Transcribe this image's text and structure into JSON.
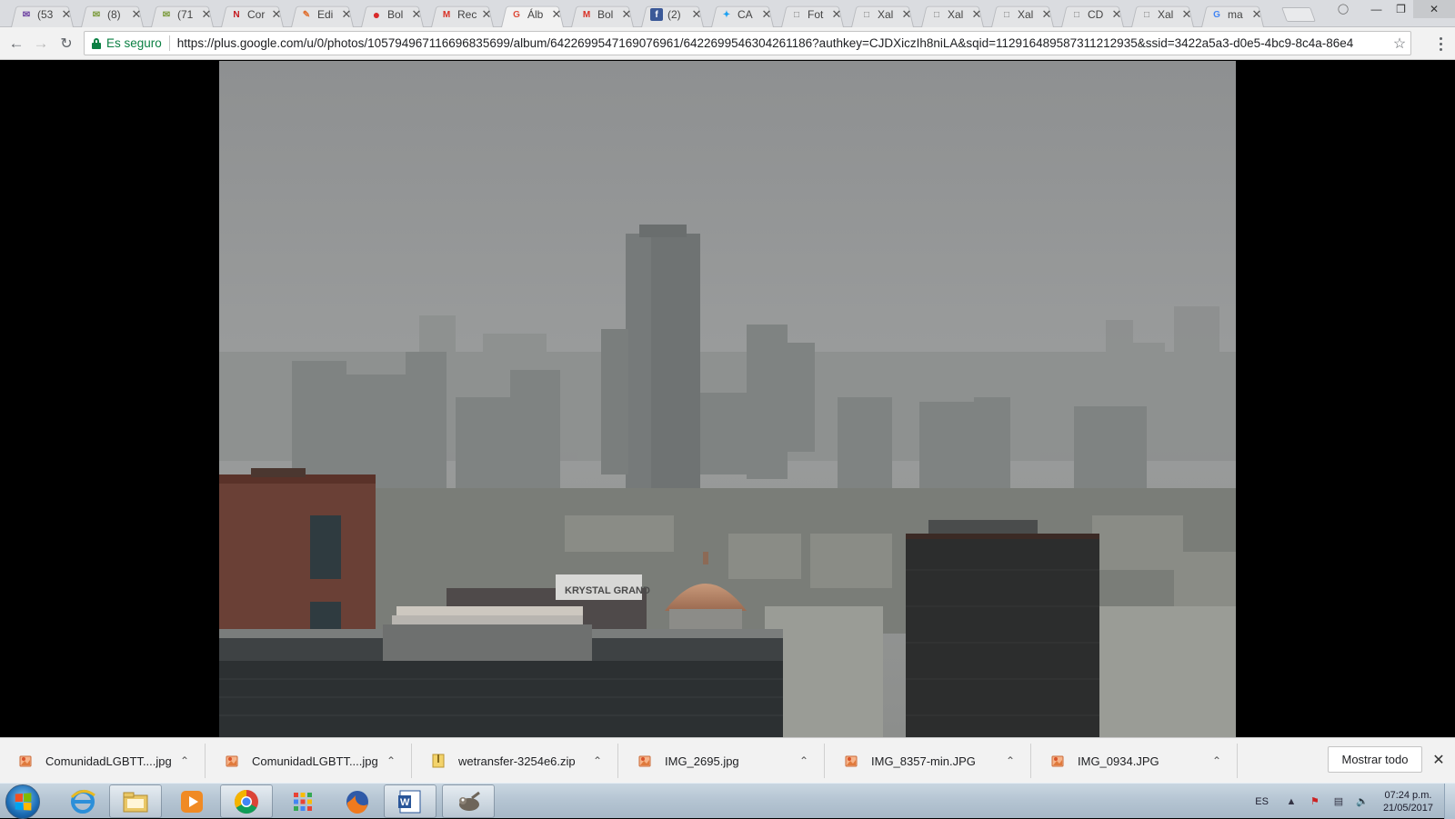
{
  "browser": {
    "tabs": [
      {
        "title": "(53",
        "icon": "mail-icon",
        "color": "#6b3fa0"
      },
      {
        "title": "(8)",
        "icon": "envelope-icon",
        "color": "#7a9a3a"
      },
      {
        "title": "(71",
        "icon": "envelope-icon",
        "color": "#7a9a3a"
      },
      {
        "title": "Cor",
        "icon": "ntx-icon",
        "color": "#c4161c"
      },
      {
        "title": "Edi",
        "icon": "edit-icon",
        "color": "#e07030"
      },
      {
        "title": "Bol",
        "icon": "red-dot-icon",
        "color": "#d92b2b"
      },
      {
        "title": "Rec",
        "icon": "gmail-icon",
        "color": "#d93025"
      },
      {
        "title": "Álb",
        "icon": "google-plus-icon",
        "color": "#dd4b39",
        "active": true
      },
      {
        "title": "Bol",
        "icon": "gmail-icon",
        "color": "#d93025"
      },
      {
        "title": "(2)",
        "icon": "facebook-icon",
        "color": "#3b5998"
      },
      {
        "title": "CA",
        "icon": "twitter-icon",
        "color": "#1da1f2"
      },
      {
        "title": "Fot",
        "icon": "page-icon",
        "color": "#777777"
      },
      {
        "title": "Xal",
        "icon": "page-icon",
        "color": "#777777"
      },
      {
        "title": "Xal",
        "icon": "page-icon",
        "color": "#777777"
      },
      {
        "title": "Xal",
        "icon": "page-icon",
        "color": "#777777"
      },
      {
        "title": "CD",
        "icon": "page-icon",
        "color": "#777777"
      },
      {
        "title": "Xal",
        "icon": "page-icon",
        "color": "#777777"
      },
      {
        "title": "ma",
        "icon": "google-icon",
        "color": "#4285f4"
      }
    ],
    "security_label": "Es seguro",
    "url": "https://plus.google.com/u/0/photos/105794967116696835699/album/6422699547169076961/6422699546304261186?authkey=CJDXiczIh8niLA&sqid=112916489587311212935&ssid=3422a5a3-d0e5-4bc9-8c4a-86e4"
  },
  "photo": {
    "sign_text": "KRYSTAL GRAND"
  },
  "downloads": {
    "items": [
      {
        "name": "ComunidadLGBTT....jpg",
        "type": "image"
      },
      {
        "name": "ComunidadLGBTT....jpg",
        "type": "image"
      },
      {
        "name": "wetransfer-3254e6.zip",
        "type": "zip"
      },
      {
        "name": "IMG_2695.jpg",
        "type": "image"
      },
      {
        "name": "IMG_8357-min.JPG",
        "type": "image"
      },
      {
        "name": "IMG_0934.JPG",
        "type": "image"
      }
    ],
    "show_all_label": "Mostrar todo"
  },
  "taskbar": {
    "apps": [
      {
        "name": "internet-explorer-icon",
        "open": false
      },
      {
        "name": "file-explorer-icon",
        "open": true
      },
      {
        "name": "media-player-icon",
        "open": false
      },
      {
        "name": "chrome-icon",
        "open": true
      },
      {
        "name": "apps-grid-icon",
        "open": false
      },
      {
        "name": "firefox-icon",
        "open": false
      },
      {
        "name": "word-icon",
        "open": true
      },
      {
        "name": "gimp-icon",
        "open": true
      }
    ],
    "language": "ES",
    "time": "07:24 p.m.",
    "date": "21/05/2017"
  }
}
